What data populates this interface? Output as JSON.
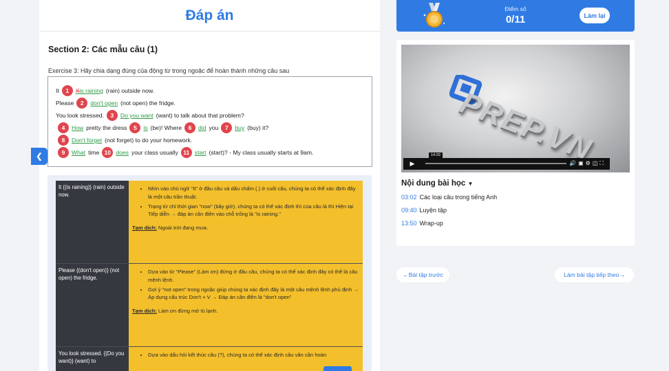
{
  "answer_title": "Đáp án",
  "section_title": "Section 2: Các mẫu câu (1)",
  "exercise_title": "Exercise 3: Hãy chia dạng đúng của động từ trong ngoặc để hoàn thành những câu sau",
  "exercise": {
    "l1": {
      "pre": "It",
      "n1": "1",
      "wrong": "X",
      "a1": "is raining",
      "post": "(rain) outside now."
    },
    "l2": {
      "pre": "Please",
      "n2": "2",
      "a2": "don't open",
      "post": "(not open) the fridge."
    },
    "l3": {
      "pre": "You look stressed.",
      "n3": "3",
      "a3": "Do you want",
      "post": "(want) to talk about that problem?"
    },
    "l4": {
      "n4": "4",
      "a4": "How",
      "t1": "pretty the dress",
      "n5": "5",
      "a5": "is",
      "t2": "(be)! Where",
      "n6": "6",
      "a6": "did",
      "t3": "you",
      "n7": "7",
      "a7": "buy",
      "t4": "(buy) it?"
    },
    "l5": {
      "n8": "8",
      "a8": "Don't forget",
      "post": "(not forget) to do your homework."
    },
    "l6": {
      "n9": "9",
      "a9": "What",
      "t1": "time",
      "n10": "10",
      "a10": "does",
      "t2": "your class usually",
      "n11": "11",
      "a11": "start",
      "t3": "(start)? - My class usually starts at 9am."
    }
  },
  "explanations": [
    {
      "left": "It {(is raining)} (rain) outside now.",
      "bullets": [
        "Nhìn vào chủ ngữ \"It\" ở đầu câu và dấu chấm (.) ở cuối câu, chúng ta có thể xác định đây là một câu trần thuật.",
        "Trạng từ chỉ thời gian \"now\" (bây giờ), chúng ta có thể xác định thì của câu là thì Hiện tại Tiếp diễn → đáp án cần điền vào chỗ trống là \"is raining.\""
      ],
      "tr_label": "Tạm dịch:",
      "tr_text": "Ngoài trời đang mưa."
    },
    {
      "left": "Please {(don't open)} (not open) the fridge.",
      "bullets": [
        "Dựa vào từ \"Please\" (Làm ơn) đứng ở đầu câu, chúng ta có thể xác định đây có thể là câu mệnh lệnh.",
        "Gợi ý \"not open\" trong ngoặc giúp chúng ta xác định đây là một câu mệnh lệnh phủ định → Áp dụng cấu trúc Don't + V → Đáp án cần điền là \"don't open\""
      ],
      "tr_label": "Tạm dịch:",
      "tr_text": "Làm ơn đừng mở tủ lạnh."
    },
    {
      "left": "You look stressed. {(Do you want)} (want) to",
      "bullets": [
        "Dựa vào dấu hỏi kết thúc câu (?), chúng ta có thể xác định câu văn cần hoàn"
      ]
    }
  ],
  "score": {
    "label": "Điểm số",
    "value": "0/11",
    "retry": "Làm lại"
  },
  "video": {
    "logo": "PREP.VN",
    "time": "14:29"
  },
  "lesson": {
    "heading": "Nội dung bài học",
    "items": [
      {
        "time": "03:02",
        "label": "Các loại câu trong tiếng Anh"
      },
      {
        "time": "09:40",
        "label": "Luyện tập"
      },
      {
        "time": "13:50",
        "label": "Wrap-up"
      }
    ]
  },
  "nav": {
    "prev": "←Bài tập trước",
    "next": "Làm bài tập tiếp theo→"
  }
}
